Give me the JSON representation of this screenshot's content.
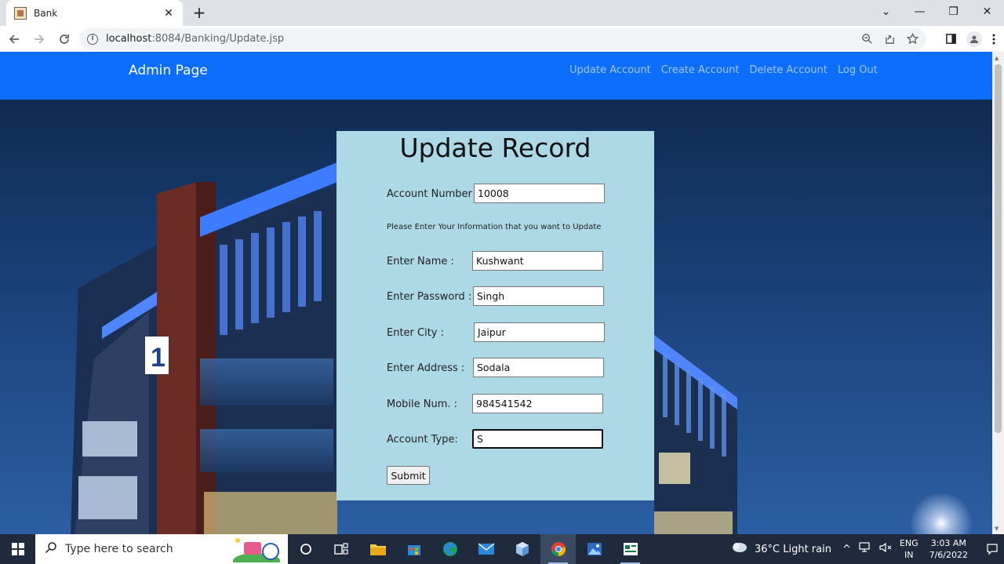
{
  "browser": {
    "tab_title": "Bank",
    "tab_close": "✕",
    "new_tab": "+",
    "url_host": "localhost",
    "url_path": ":8084/Banking/Update.jsp",
    "win_minimize": "—",
    "win_restore": "❐",
    "win_close": "✕",
    "win_tabsearch": "⌄"
  },
  "navbar": {
    "brand": "Admin Page",
    "links": [
      "Update Account",
      "Create Account",
      "Delete Account",
      "Log Out"
    ]
  },
  "form": {
    "title": "Update Record",
    "account_number_label": "Account Number :",
    "account_number_value": "10008",
    "hint": "Please Enter Your Information that you want to Update",
    "name_label": "Enter Name :",
    "name_value": "Kushwant",
    "password_label": "Enter Password :",
    "password_value": "Singh",
    "city_label": "Enter City :",
    "city_value": "Jaipur",
    "address_label": "Enter Address :",
    "address_value": "Sodala",
    "mobile_label": "Mobile Num. :",
    "mobile_value": "984541542",
    "type_label": "Account Type:",
    "type_value": "S",
    "submit_label": "Submit"
  },
  "taskbar": {
    "search_placeholder": "Type here to search",
    "weather": "36°C  Light rain",
    "lang_line1": "ENG",
    "lang_line2": "IN",
    "time": "3:03 AM",
    "date": "7/6/2022"
  },
  "colors": {
    "navbar": "#0d6efd",
    "panel": "#add8e6",
    "taskbar": "#1f2a3d"
  }
}
